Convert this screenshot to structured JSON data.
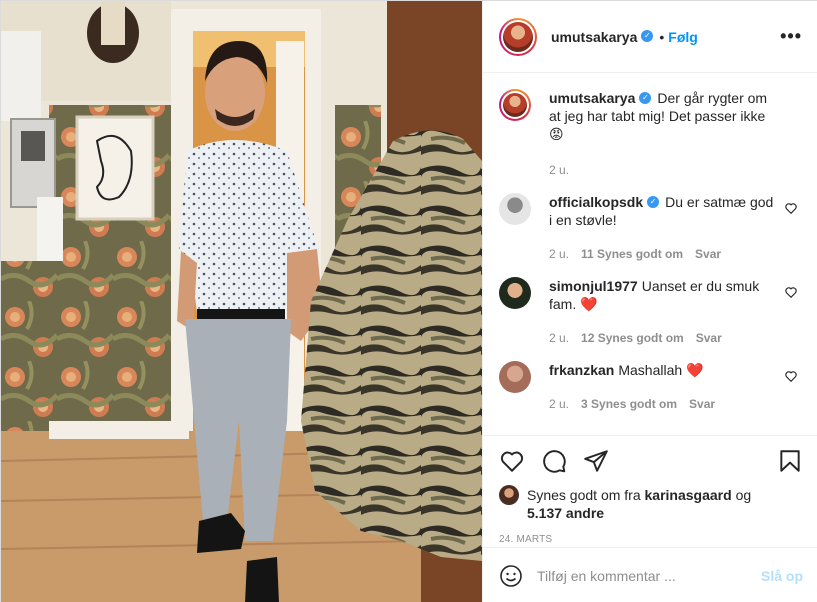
{
  "post": {
    "username": "umutsakarya",
    "follow_label": "Følg",
    "separator": "•",
    "more_label": "•••",
    "caption": "Der går rygter om at jeg har tabt mig! Det passer ikke 😡",
    "caption_age": "2 u."
  },
  "comments": [
    {
      "username": "officialkopsdk",
      "verified": true,
      "text": "Du er satmæ god i en støvle!",
      "age": "2 u.",
      "likes": "11 Synes godt om",
      "reply": "Svar",
      "avatar_color": "#cfcfcf"
    },
    {
      "username": "simonjul1977",
      "verified": false,
      "text": "Uanset er du smuk fam. ❤️",
      "age": "2 u.",
      "likes": "12 Synes godt om",
      "reply": "Svar",
      "avatar_color": "#2f3a2c"
    },
    {
      "username": "frkanzkan",
      "verified": false,
      "text": "Mashallah ❤️",
      "age": "2 u.",
      "likes": "3 Synes godt om",
      "reply": "Svar",
      "avatar_color": "#c99a86"
    }
  ],
  "likes": {
    "prefix": "Synes godt om fra",
    "user": "karinasgaard",
    "joiner": "og",
    "others": "5.137 andre"
  },
  "date": "24. MARTS",
  "add_comment": {
    "placeholder": "Tilføj en kommentar ...",
    "post_label": "Slå op"
  },
  "colors": {
    "accent": "#0095f6",
    "verified": "#3897f0",
    "heart_red": "#ed4956"
  },
  "icons": [
    "heart-icon",
    "comment-icon",
    "share-icon",
    "bookmark-icon",
    "emoji-icon",
    "verified-icon"
  ]
}
